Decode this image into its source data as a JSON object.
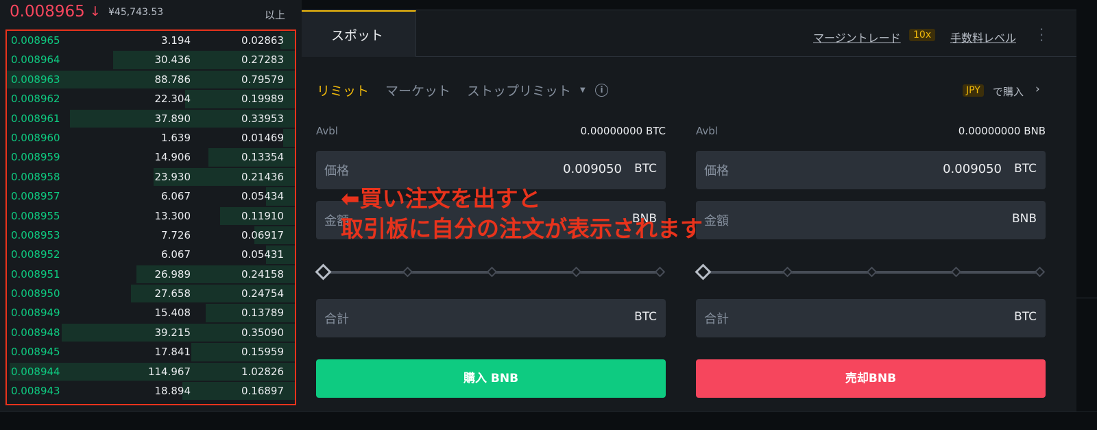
{
  "header": {
    "last_price": "0.008965",
    "arrow": "↓",
    "fiat_price": "¥45,743.53",
    "more": "以上"
  },
  "order_book": {
    "rows": [
      {
        "price": "0.008965",
        "amount": "3.194",
        "total": "0.02863",
        "depth": 0.05
      },
      {
        "price": "0.008964",
        "amount": "30.436",
        "total": "0.27283",
        "depth": 0.63
      },
      {
        "price": "0.008963",
        "amount": "88.786",
        "total": "0.79579",
        "depth": 1.0
      },
      {
        "price": "0.008962",
        "amount": "22.304",
        "total": "0.19989",
        "depth": 0.38
      },
      {
        "price": "0.008961",
        "amount": "37.890",
        "total": "0.33953",
        "depth": 0.78
      },
      {
        "price": "0.008960",
        "amount": "1.639",
        "total": "0.01469",
        "depth": 0.04
      },
      {
        "price": "0.008959",
        "amount": "14.906",
        "total": "0.13354",
        "depth": 0.3
      },
      {
        "price": "0.008958",
        "amount": "23.930",
        "total": "0.21436",
        "depth": 0.49
      },
      {
        "price": "0.008957",
        "amount": "6.067",
        "total": "0.05434",
        "depth": 0.1
      },
      {
        "price": "0.008955",
        "amount": "13.300",
        "total": "0.11910",
        "depth": 0.26
      },
      {
        "price": "0.008953",
        "amount": "7.726",
        "total": "0.06917",
        "depth": 0.14
      },
      {
        "price": "0.008952",
        "amount": "6.067",
        "total": "0.05431",
        "depth": 0.1
      },
      {
        "price": "0.008951",
        "amount": "26.989",
        "total": "0.24158",
        "depth": 0.55
      },
      {
        "price": "0.008950",
        "amount": "27.658",
        "total": "0.24754",
        "depth": 0.57
      },
      {
        "price": "0.008949",
        "amount": "15.408",
        "total": "0.13789",
        "depth": 0.31
      },
      {
        "price": "0.008948",
        "amount": "39.215",
        "total": "0.35090",
        "depth": 0.81
      },
      {
        "price": "0.008945",
        "amount": "17.841",
        "total": "0.15959",
        "depth": 0.36
      },
      {
        "price": "0.008944",
        "amount": "114.967",
        "total": "1.02826",
        "depth": 0.99
      },
      {
        "price": "0.008943",
        "amount": "18.894",
        "total": "0.16897",
        "depth": 0.39
      }
    ]
  },
  "trade": {
    "tab_spot": "スポット",
    "margin_link": "マージントレード",
    "leverage": "10x",
    "fee_link": "手数料レベル",
    "order_types": {
      "limit": "リミット",
      "market": "マーケット",
      "stop_limit": "ストップリミット"
    },
    "jpy_badge": "JPY",
    "jpy_buy": "で購入",
    "buy": {
      "avbl_label": "Avbl",
      "avbl_value": "0.00000000 BTC",
      "price_label": "価格",
      "price_value": "0.009050",
      "price_unit": "BTC",
      "amount_label": "金額",
      "amount_unit": "BNB",
      "total_label": "合計",
      "total_unit": "BTC",
      "button": "購入 BNB"
    },
    "sell": {
      "avbl_label": "Avbl",
      "avbl_value": "0.00000000 BNB",
      "price_label": "価格",
      "price_value": "0.009050",
      "price_unit": "BTC",
      "amount_label": "金額",
      "amount_unit": "BNB",
      "total_label": "合計",
      "total_unit": "BTC",
      "button": "売却BNB"
    }
  },
  "annotation": {
    "line1": "⬅買い注文を出すと",
    "line2": "取引板に自分の注文が表示されます"
  },
  "colors": {
    "buy_green": "#0ecb81",
    "sell_red": "#f6465d",
    "accent_yellow": "#f0b90b",
    "annotation_red": "#e8331c"
  }
}
